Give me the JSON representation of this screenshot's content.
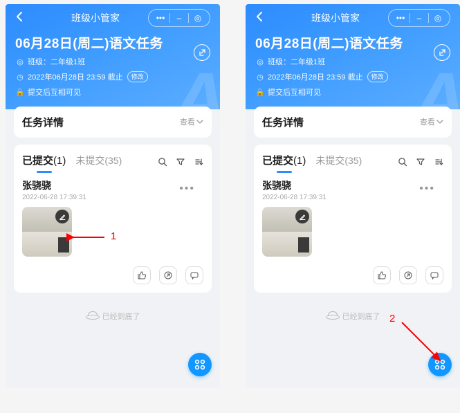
{
  "topbar": {
    "title": "班级小管家"
  },
  "header": {
    "task_title": "06月28日(周二)语文任务",
    "class_label": "班级：",
    "class_value": "二年级1班",
    "deadline_text": "2022年06月28日 23:59 截止",
    "modify_label": "修改",
    "visibility_text": "提交后互相可见"
  },
  "details_card": {
    "title": "任务详情",
    "view_label": "查看"
  },
  "tabs": {
    "submitted_label": "已提交",
    "submitted_count": "(1)",
    "unsubmitted_label": "未提交(35)"
  },
  "submission": {
    "student_name": "张骁骁",
    "time": "2022-06-28 17:39:31"
  },
  "footer": {
    "end_text": "已经到底了"
  },
  "annotations": {
    "label1": "1",
    "label2": "2"
  }
}
